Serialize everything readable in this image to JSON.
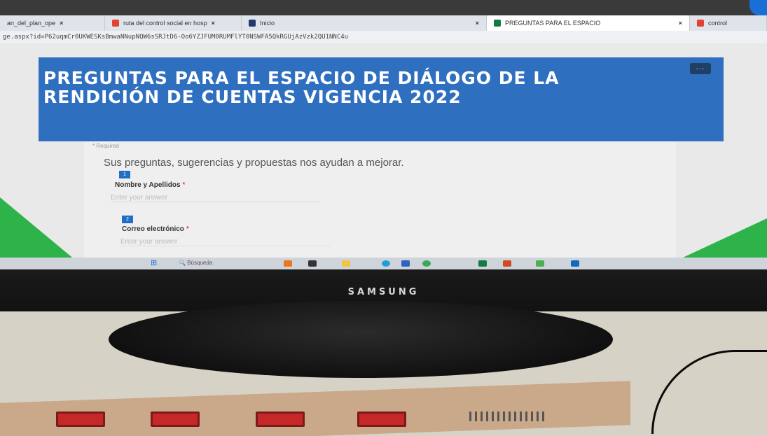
{
  "browser": {
    "tabs": [
      {
        "label": "an_del_plan_ope",
        "favicon_color": "#ffffff",
        "active": false
      },
      {
        "label": "ruta del control social en hosp",
        "favicon_color": "#e34133",
        "active": false
      },
      {
        "label": "Inicio",
        "favicon_color": "#223a6b",
        "active": false
      },
      {
        "label": "PREGUNTAS PARA EL ESPACIO",
        "favicon_color": "#107c41",
        "active": true
      },
      {
        "label": "control",
        "favicon_color": "#e34133",
        "active": false
      }
    ],
    "close_glyph": "×",
    "address": "ge.aspx?id=P62uqmCr0UKWESKsBmwaNNupNQW6sSRJtD6-Oo6YZJFUM0RUMFlYT0NSWFA5QkRGUjAzVzk2QU1NNC4u"
  },
  "form": {
    "title": "PREGUNTAS PARA EL ESPACIO DE DIÁLOGO DE LA RENDICIÓN DE CUENTAS VIGENCIA 2022",
    "more_label": "···",
    "required_note": "* Required",
    "intro": "Sus preguntas, sugerencias y propuestas nos ayudan a mejorar.",
    "questions": [
      {
        "number": "1",
        "label": "Nombre y Apellidos",
        "required_mark": "*",
        "placeholder": "Enter your answer"
      },
      {
        "number": "2",
        "label": "Correo electrónico",
        "required_mark": "*",
        "placeholder": "Enter your answer"
      }
    ]
  },
  "taskbar": {
    "search_label": "Búsqueda",
    "icons": [
      "start-icon",
      "weather-icon",
      "explorer-icon",
      "folder-icon",
      "edge-icon",
      "store-icon",
      "chrome-icon",
      "excel-icon",
      "powerpoint-icon",
      "app-icon",
      "outlook-icon"
    ]
  },
  "monitor": {
    "brand": "SAMSUNG"
  },
  "colors": {
    "banner": "#2f6fbf",
    "accent_green": "#2eb34a",
    "question_badge": "#1f6fc7"
  }
}
